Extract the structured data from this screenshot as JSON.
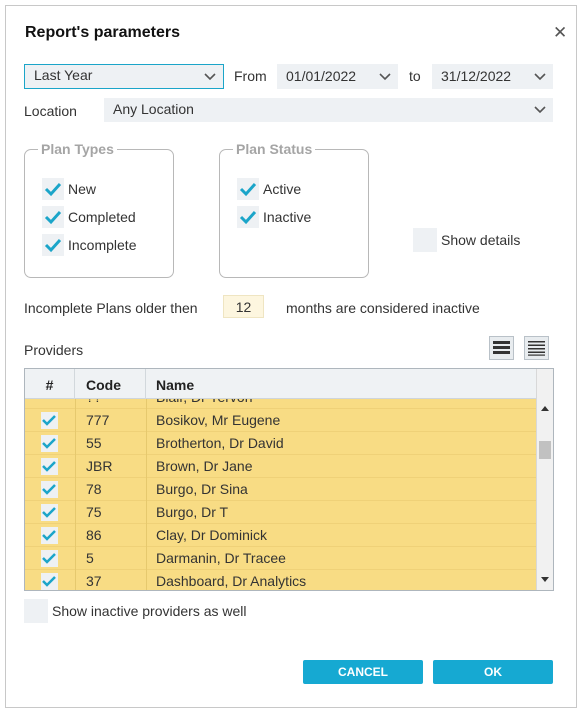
{
  "dialog": {
    "title": "Report's parameters"
  },
  "period": {
    "selected": "Last Year",
    "from_label": "From",
    "from": "01/01/2022",
    "to_label": "to",
    "to": "31/12/2022"
  },
  "location": {
    "label": "Location",
    "selected": "Any Location"
  },
  "plan_types": {
    "title": "Plan Types",
    "items": [
      {
        "label": "New",
        "checked": true
      },
      {
        "label": "Completed",
        "checked": true
      },
      {
        "label": "Incomplete",
        "checked": true
      }
    ]
  },
  "plan_status": {
    "title": "Plan Status",
    "items": [
      {
        "label": "Active",
        "checked": true
      },
      {
        "label": "Inactive",
        "checked": true
      }
    ]
  },
  "show_details": {
    "label": "Show details",
    "checked": false
  },
  "inactive_rule": {
    "prefix": "Incomplete Plans older then",
    "months": "12",
    "suffix": "months are considered inactive"
  },
  "providers": {
    "label": "Providers",
    "columns": [
      "#",
      "Code",
      "Name"
    ],
    "partial_row": {
      "code": "??",
      "name": "Blair, Dr Yervon"
    },
    "rows": [
      {
        "code": "777",
        "name": "Bosikov, Mr Eugene",
        "checked": true
      },
      {
        "code": "55",
        "name": "Brotherton, Dr David",
        "checked": true
      },
      {
        "code": "JBR",
        "name": "Brown, Dr Jane",
        "checked": true
      },
      {
        "code": "78",
        "name": "Burgo, Dr Sina",
        "checked": true
      },
      {
        "code": "75",
        "name": "Burgo, Dr T",
        "checked": true
      },
      {
        "code": "86",
        "name": "Clay, Dr Dominick",
        "checked": true
      },
      {
        "code": "5",
        "name": "Darmanin, Dr Tracee",
        "checked": true
      },
      {
        "code": "37",
        "name": "Dashboard, Dr Analytics",
        "checked": true
      }
    ]
  },
  "show_inactive": {
    "label": "Show inactive providers as well",
    "checked": false
  },
  "buttons": {
    "cancel": "CANCEL",
    "ok": "OK"
  },
  "colors": {
    "accent": "#16a9d2",
    "row_highlight": "#f8dc84",
    "check": "#1ba5c9"
  }
}
